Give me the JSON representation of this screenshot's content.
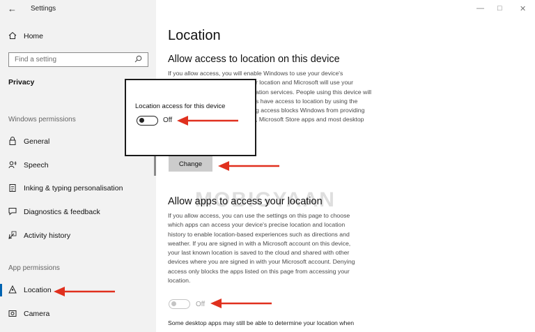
{
  "window": {
    "title": "Settings",
    "minimize_icon": "minimize-icon",
    "maximize_icon": "maximize-icon",
    "close_icon": "close-icon"
  },
  "sidebar": {
    "home_label": "Home",
    "search_placeholder": "Find a setting",
    "section_title": "Privacy",
    "windows_permissions_label": "Windows permissions",
    "app_permissions_label": "App permissions",
    "items": [
      {
        "label": "General",
        "icon": "lock-icon"
      },
      {
        "label": "Speech",
        "icon": "speech-icon"
      },
      {
        "label": "Inking & typing personalisation",
        "icon": "clipboard-icon"
      },
      {
        "label": "Diagnostics & feedback",
        "icon": "feedback-icon"
      },
      {
        "label": "Activity history",
        "icon": "history-icon"
      }
    ],
    "app_items": [
      {
        "label": "Location",
        "icon": "location-icon",
        "selected": true
      },
      {
        "label": "Camera",
        "icon": "camera-icon"
      }
    ]
  },
  "main": {
    "page_title": "Location",
    "device_section": {
      "heading": "Allow access to location on this device",
      "lines": [
        "If you allow access, you will enable Windows to use your device's",
        "r location and Microsoft will use your",
        "ation services. People using this device will",
        "s have access to location by using the",
        "g access blocks Windows from providing",
        ", Microsoft Store apps and most desktop"
      ],
      "change_label": "Change"
    },
    "apps_section": {
      "heading": "Allow apps to access your location",
      "lines": [
        "If you allow access, you can use the settings on this page to choose",
        "which apps can access your device's precise location and location",
        "history to enable location-based experiences such as directions and",
        "weather. If you are signed in with a Microsoft account on this device,",
        "your last known location is saved to the cloud and shared with other",
        "devices where you are signed in with your Microsoft account. Denying",
        "access only blocks the apps listed on this page from accessing your",
        "location."
      ],
      "toggle_state": "Off",
      "footer_text": "Some desktop apps may still be able to determine your location when"
    }
  },
  "popup": {
    "title": "Location access for this device",
    "toggle_state": "Off"
  },
  "watermark": "MOBIGYAAN",
  "colors": {
    "annotation_arrow": "#e0301e",
    "accent": "#0063b1",
    "sidebar_bg": "#f2f2f2"
  }
}
